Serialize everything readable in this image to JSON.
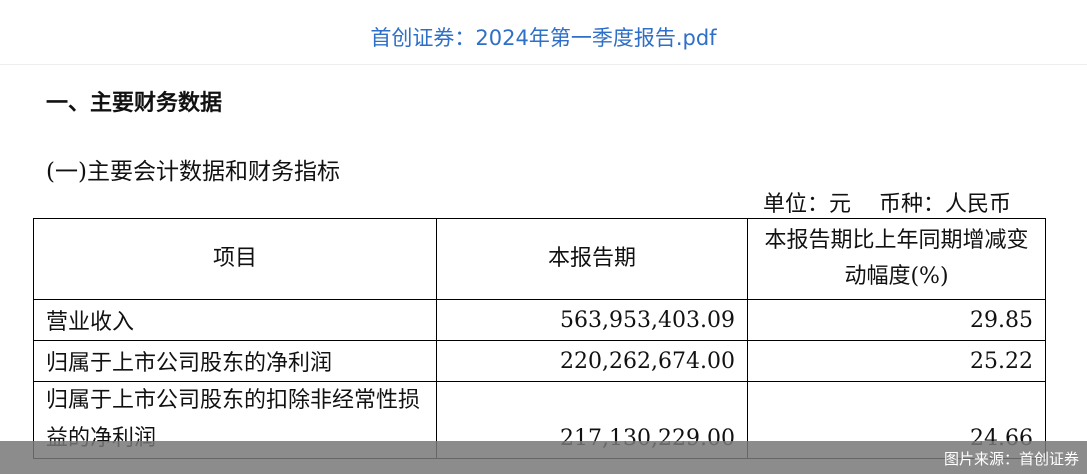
{
  "header": {
    "doc_title": "首创证券：2024年第一季度报告.pdf"
  },
  "section": {
    "title": "一、主要财务数据",
    "subtitle": "(一)主要会计数据和财务指标",
    "unit_note": "单位：元    币种：人民币"
  },
  "table": {
    "headers": [
      "项目",
      "本报告期",
      "本报告期比上年同期增减变动幅度(%)"
    ],
    "rows": [
      {
        "item": "营业收入",
        "current": "563,953,403.09",
        "change": "29.85"
      },
      {
        "item": "归属于上市公司股东的净利润",
        "current": "220,262,674.00",
        "change": "25.22"
      },
      {
        "item": "归属于上市公司股东的扣除非经常性损益的净利润",
        "current": "217,130,229.00",
        "change": "24.66"
      }
    ]
  },
  "footer": {
    "source": "图片来源：首创证券"
  }
}
